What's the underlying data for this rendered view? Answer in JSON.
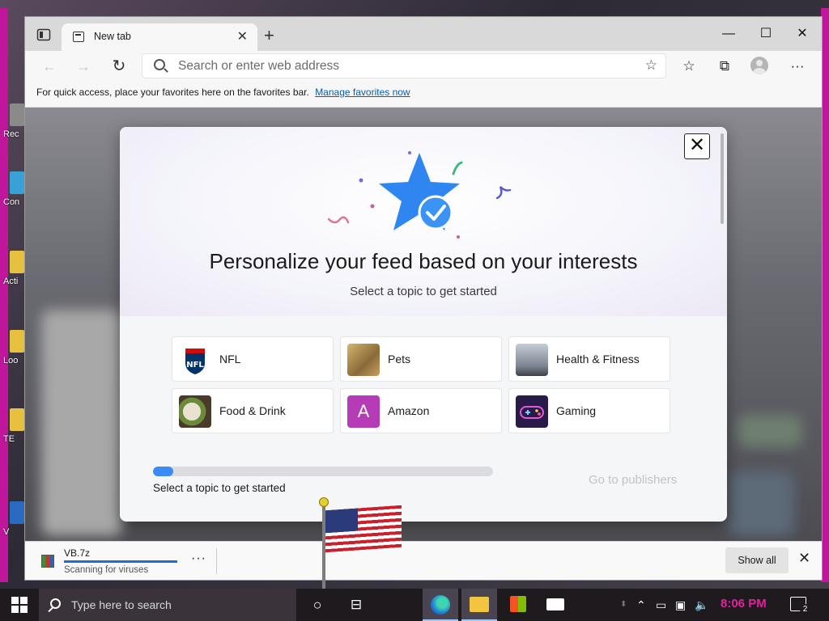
{
  "browser": {
    "tab_title": "New tab",
    "new_tab_symbol": "+",
    "close_tab_symbol": "✕",
    "window_controls": {
      "minimize": "—",
      "maximize": "☐",
      "close": "✕"
    },
    "address_placeholder": "Search or enter web address",
    "favorites_bar": {
      "message": "For quick access, place your favorites here on the favorites bar.",
      "link": "Manage favorites now"
    }
  },
  "dialog": {
    "title": "Personalize your feed based on your interests",
    "subtitle": "Select a topic to get started",
    "close_symbol": "✕",
    "topics": [
      {
        "label": "NFL",
        "icon": "nfl-shield-icon"
      },
      {
        "label": "Pets",
        "icon": "pets-photo-icon"
      },
      {
        "label": "Health & Fitness",
        "icon": "runner-photo-icon"
      },
      {
        "label": "Food & Drink",
        "icon": "food-photo-icon"
      },
      {
        "label": "Amazon",
        "icon": "amazon-letter-icon",
        "letter": "A"
      },
      {
        "label": "Gaming",
        "icon": "gamepad-icon"
      }
    ],
    "progress": 0.06,
    "progress_label": "Select a topic to get started",
    "go_publishers": "Go to publishers",
    "colors": {
      "accent": "#3a8bf5",
      "amazon": "#b53bb7"
    }
  },
  "downloads": {
    "file_name": "VB.7z",
    "status": "Scanning for viruses",
    "more_symbol": "···",
    "progress": 1.0,
    "show_all": "Show all",
    "close_symbol": "✕"
  },
  "taskbar": {
    "search_placeholder": "Type here to search",
    "clock": "8:06 PM",
    "notification_count": "2",
    "colors": {
      "clock": "#e4209e"
    }
  },
  "desktop": {
    "icon_labels": [
      "Rec",
      "Con",
      "Acti",
      "Loo",
      "TE",
      "V"
    ]
  }
}
